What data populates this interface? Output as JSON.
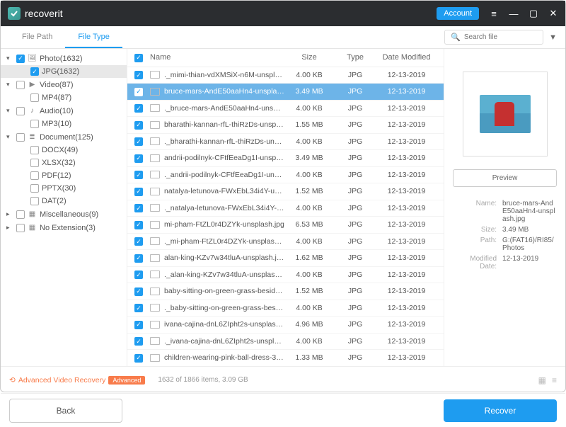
{
  "app": {
    "name": "recoverit",
    "account": "Account"
  },
  "tabs": {
    "path": "File Path",
    "type": "File Type"
  },
  "search": {
    "placeholder": "Search file"
  },
  "sidebar": [
    {
      "label": "Photo(1632)",
      "icon": "🖼",
      "checked": true,
      "expand": "▾",
      "children": [
        {
          "label": "JPG(1632)",
          "checked": true,
          "selected": true
        }
      ]
    },
    {
      "label": "Video(87)",
      "icon": "▶",
      "checked": false,
      "expand": "▾",
      "children": [
        {
          "label": "MP4(87)",
          "checked": false
        }
      ]
    },
    {
      "label": "Audio(10)",
      "icon": "♪",
      "checked": false,
      "expand": "▾",
      "children": [
        {
          "label": "MP3(10)",
          "checked": false
        }
      ]
    },
    {
      "label": "Document(125)",
      "icon": "≣",
      "checked": false,
      "expand": "▾",
      "children": [
        {
          "label": "DOCX(49)"
        },
        {
          "label": "XLSX(32)"
        },
        {
          "label": "PDF(12)"
        },
        {
          "label": "PPTX(30)"
        },
        {
          "label": "DAT(2)"
        }
      ]
    },
    {
      "label": "Miscellaneous(9)",
      "icon": "▦",
      "checked": false,
      "expand": "▸"
    },
    {
      "label": "No Extension(3)",
      "icon": "▦",
      "checked": false,
      "expand": "▸"
    }
  ],
  "cols": {
    "name": "Name",
    "size": "Size",
    "type": "Type",
    "date": "Date Modified"
  },
  "files": [
    {
      "name": "._mimi-thian-vdXMSiX-n6M-unsplash...",
      "size": "4.00 KB",
      "type": "JPG",
      "date": "12-13-2019"
    },
    {
      "name": "bruce-mars-AndE50aaHn4-unsplash...",
      "size": "3.49 MB",
      "type": "JPG",
      "date": "12-13-2019",
      "sel": true
    },
    {
      "name": "._bruce-mars-AndE50aaHn4-unsplas...",
      "size": "4.00 KB",
      "type": "JPG",
      "date": "12-13-2019"
    },
    {
      "name": "bharathi-kannan-rfL-thiRzDs-unspla...",
      "size": "1.55 MB",
      "type": "JPG",
      "date": "12-13-2019"
    },
    {
      "name": "._bharathi-kannan-rfL-thiRzDs-unspl...",
      "size": "4.00 KB",
      "type": "JPG",
      "date": "12-13-2019"
    },
    {
      "name": "andrii-podilnyk-CFtfEeaDg1I-unspla...",
      "size": "3.49 MB",
      "type": "JPG",
      "date": "12-13-2019"
    },
    {
      "name": "._andrii-podilnyk-CFtfEeaDg1I-unspla...",
      "size": "4.00 KB",
      "type": "JPG",
      "date": "12-13-2019"
    },
    {
      "name": "natalya-letunova-FWxEbL34i4Y-unspl...",
      "size": "1.52 MB",
      "type": "JPG",
      "date": "12-13-2019"
    },
    {
      "name": "._natalya-letunova-FWxEbL34i4Y-uns...",
      "size": "4.00 KB",
      "type": "JPG",
      "date": "12-13-2019"
    },
    {
      "name": "mi-pham-FtZL0r4DZYk-unsplash.jpg",
      "size": "6.53 MB",
      "type": "JPG",
      "date": "12-13-2019"
    },
    {
      "name": "._mi-pham-FtZL0r4DZYk-unsplash.jpg",
      "size": "4.00 KB",
      "type": "JPG",
      "date": "12-13-2019"
    },
    {
      "name": "alan-king-KZv7w34tluA-unsplash.jpg",
      "size": "1.62 MB",
      "type": "JPG",
      "date": "12-13-2019"
    },
    {
      "name": "._alan-king-KZv7w34tluA-unsplash.jpg",
      "size": "4.00 KB",
      "type": "JPG",
      "date": "12-13-2019"
    },
    {
      "name": "baby-sitting-on-green-grass-beside-...",
      "size": "1.52 MB",
      "type": "JPG",
      "date": "12-13-2019"
    },
    {
      "name": "._baby-sitting-on-green-grass-beside...",
      "size": "4.00 KB",
      "type": "JPG",
      "date": "12-13-2019"
    },
    {
      "name": "ivana-cajina-dnL6ZIpht2s-unsplash.jpg",
      "size": "4.96 MB",
      "type": "JPG",
      "date": "12-13-2019"
    },
    {
      "name": "._ivana-cajina-dnL6ZIpht2s-unsplash...",
      "size": "4.00 KB",
      "type": "JPG",
      "date": "12-13-2019"
    },
    {
      "name": "children-wearing-pink-ball-dress-360...",
      "size": "1.33 MB",
      "type": "JPG",
      "date": "12-13-2019"
    }
  ],
  "preview": {
    "btn": "Preview",
    "name_k": "Name:",
    "name_v": "bruce-mars-AndE50aaHn4-unsplash.jpg",
    "size_k": "Size:",
    "size_v": "3.49 MB",
    "path_k": "Path:",
    "path_v": "G:(FAT16)/RI85/Photos",
    "date_k": "Modified Date:",
    "date_v": "12-13-2019"
  },
  "footer": {
    "avr": "Advanced Video Recovery",
    "badge": "Advanced",
    "status": "1632 of 1866 items, 3.09 GB"
  },
  "buttons": {
    "back": "Back",
    "recover": "Recover"
  }
}
